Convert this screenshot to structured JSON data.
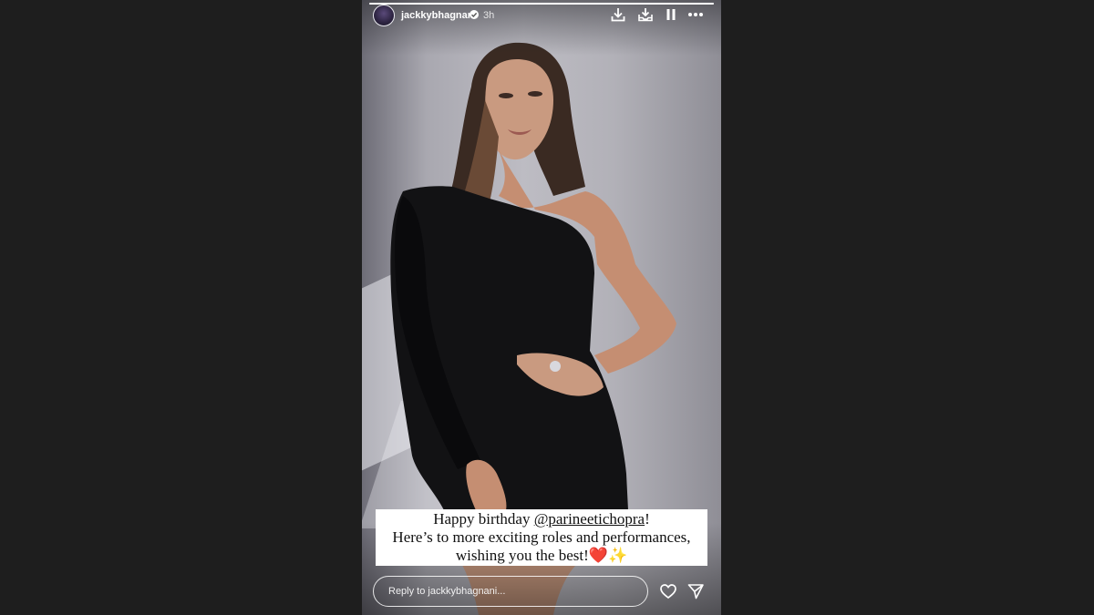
{
  "story": {
    "progress": 1.0,
    "user": {
      "username": "jackkybhagnani",
      "time_ago": "3h",
      "verified": true
    },
    "header_icons": [
      "download-icon",
      "download-tray-icon",
      "pause-icon",
      "more-icon"
    ],
    "caption": {
      "line1_prefix": "Happy birthday ",
      "mention": "@parineetichopra",
      "line1_suffix": "!",
      "line2": "Here’s to more exciting roles and performances,",
      "line3": "wishing you the best!❤️✨"
    },
    "footer": {
      "reply_placeholder": "Reply to jackkybhagnani...",
      "icons": [
        "heart-icon",
        "send-icon"
      ]
    }
  },
  "colors": {
    "page_background": "#1e1e1e",
    "caption_background": "#ffffff",
    "text_light": "#ffffff"
  }
}
